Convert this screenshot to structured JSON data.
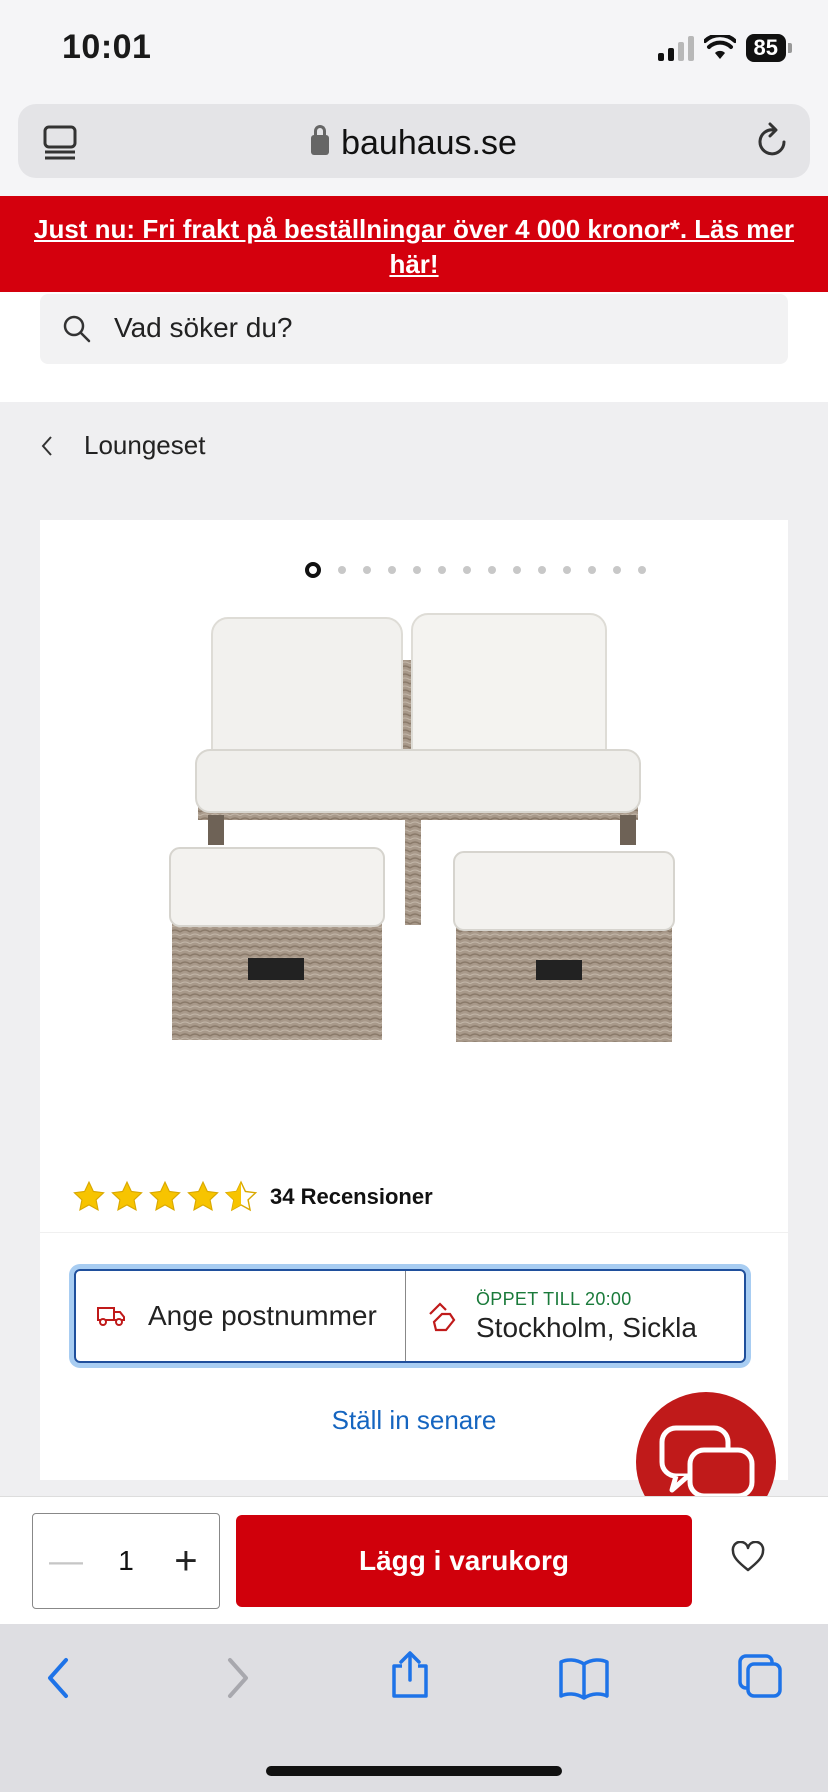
{
  "status_bar": {
    "time": "10:01",
    "battery": "85"
  },
  "browser": {
    "url": "bauhaus.se"
  },
  "promo": {
    "text": "Just nu: Fri frakt på beställningar över 4 000 kronor*. Läs mer här!"
  },
  "search": {
    "placeholder": "Vad söker du?"
  },
  "breadcrumb": {
    "label": "Loungeset"
  },
  "gallery": {
    "total_images": 14,
    "active_index": 0
  },
  "rating": {
    "value": 4.5,
    "max": 5,
    "reviews_label": "34 Recensioner"
  },
  "delivery": {
    "postcode_label": "Ange postnummer",
    "store_status": "ÖPPET TILL 20:00",
    "store_name": "Stockholm, Sickla",
    "set_later_label": "Ställ in senare"
  },
  "cart": {
    "quantity": "1",
    "minus": "—",
    "plus": "+",
    "add_label": "Lägg i varukorg"
  },
  "colors": {
    "brand_red": "#d0000b",
    "link_blue": "#1565c0",
    "open_green": "#1a7a3a",
    "star_yellow": "#f7c400"
  }
}
